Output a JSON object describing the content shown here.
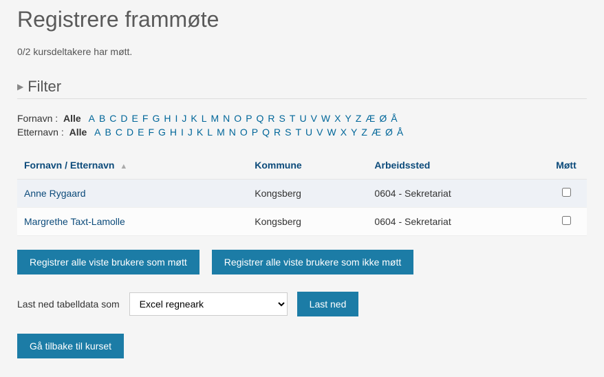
{
  "page": {
    "title": "Registrere frammøte",
    "status": "0/2 kursdeltakere har møtt."
  },
  "filter": {
    "heading": "Filter",
    "fornavn_label": "Fornavn :",
    "etternavn_label": "Etternavn :",
    "all": "Alle",
    "letters": [
      "A",
      "B",
      "C",
      "D",
      "E",
      "F",
      "G",
      "H",
      "I",
      "J",
      "K",
      "L",
      "M",
      "N",
      "O",
      "P",
      "Q",
      "R",
      "S",
      "T",
      "U",
      "V",
      "W",
      "X",
      "Y",
      "Z",
      "Æ",
      "Ø",
      "Å"
    ]
  },
  "table": {
    "headers": {
      "name": "Fornavn / Etternavn",
      "kommune": "Kommune",
      "arbeidssted": "Arbeidssted",
      "mott": "Møtt"
    },
    "rows": [
      {
        "name": "Anne Rygaard",
        "kommune": "Kongsberg",
        "arbeidssted": "0604 - Sekretariat",
        "mott": false
      },
      {
        "name": "Margrethe Taxt-Lamolle",
        "kommune": "Kongsberg",
        "arbeidssted": "0604 - Sekretariat",
        "mott": false
      }
    ]
  },
  "buttons": {
    "register_met": "Registrer alle viste brukere som møtt",
    "register_not_met": "Registrer alle viste brukere som ikke møtt",
    "download": "Last ned",
    "back": "Gå tilbake til kurset"
  },
  "download": {
    "label": "Last ned tabelldata som",
    "selected": "Excel regneark",
    "options": [
      "Excel regneark"
    ]
  }
}
